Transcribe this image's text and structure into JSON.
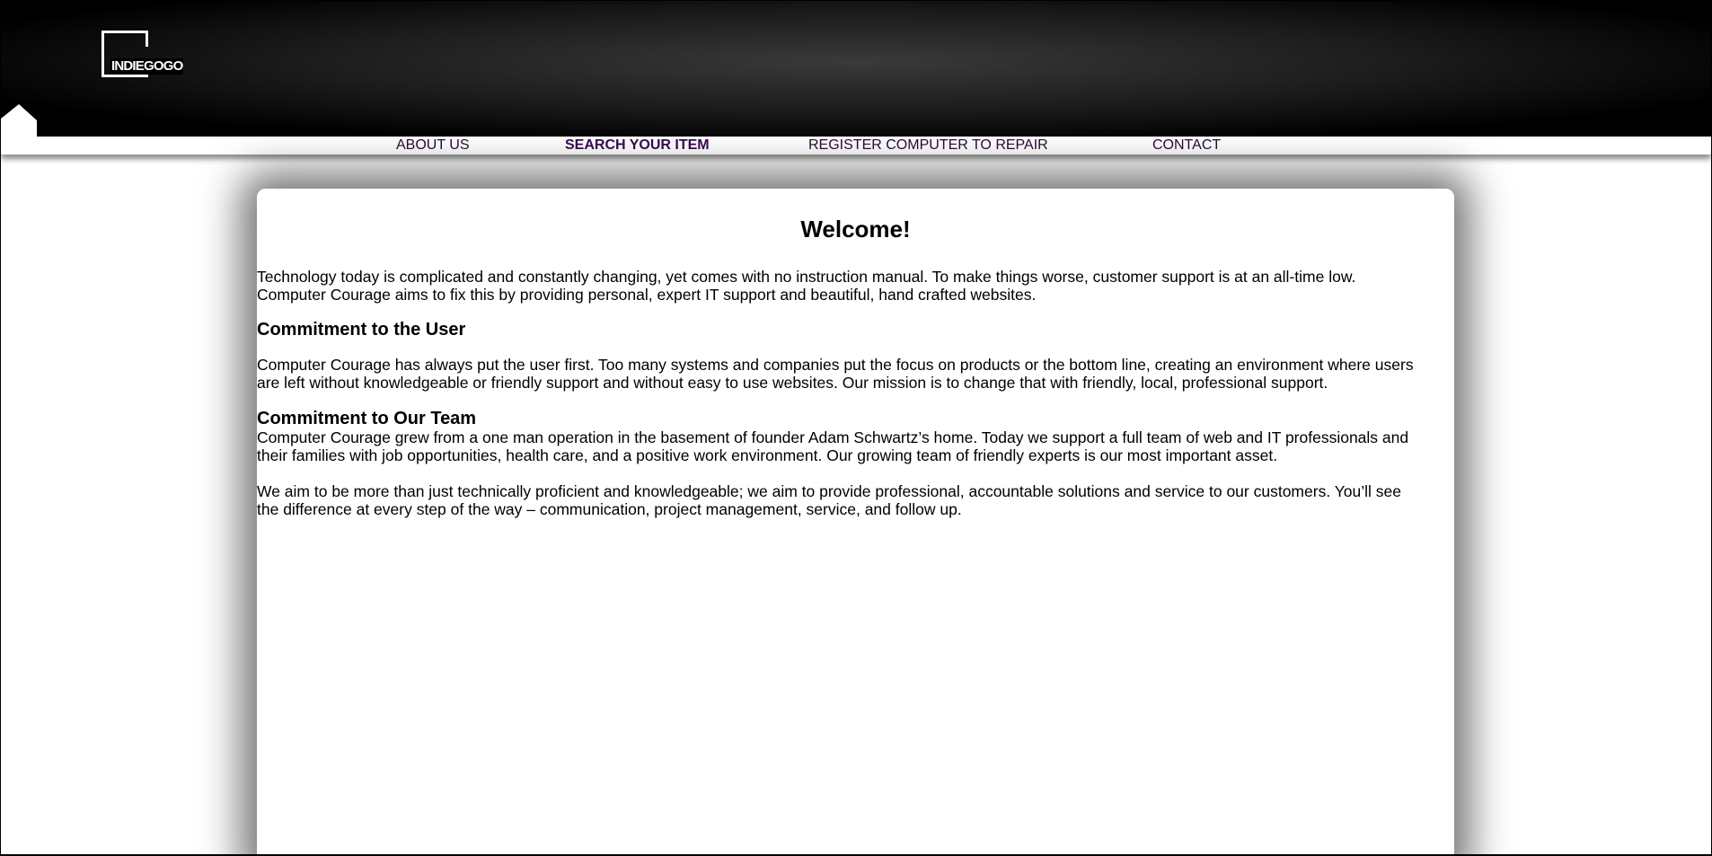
{
  "header": {
    "logo_text": "INDIEGOGO"
  },
  "nav": {
    "items": [
      {
        "label": "ABOUT US"
      },
      {
        "label": "SEARCH YOUR ITEM"
      },
      {
        "label": "REGISTER COMPUTER TO REPAIR"
      },
      {
        "label": "CONTACT"
      }
    ],
    "active": "SEARCH YOUR ITEM"
  },
  "main": {
    "title": "Welcome!",
    "intro_line1": "Technology today is complicated and constantly changing, yet comes with no instruction manual. To make things worse, customer support is at an all-time low.",
    "intro_line2": "Computer Courage aims to fix this by providing personal, expert IT support and beautiful, hand crafted websites.",
    "section1_heading": "Commitment to the User",
    "section1_line1": "Computer Courage has always put the user first. Too many systems and companies put the focus on products or the bottom line, creating an environment where users",
    "section1_line2": "are left without knowledgeable or friendly support and without easy to use websites. Our mission is to change that with friendly, local, professional support.",
    "section2_heading": "Commitment to Our Team",
    "section2_line1": "Computer Courage grew from a one man operation in the basement of founder Adam Schwartz’s home. Today we support a full team of web and IT professionals and",
    "section2_line2": "their families with job opportunities, health care, and a positive work environment. Our growing team of friendly experts is our most important asset.",
    "closing_line1": "We aim to be more than just technically proficient and knowledgeable; we aim to provide professional, accountable solutions and service to our customers. You’ll see",
    "closing_line2": "the difference at every step of the way – communication, project management, service, and follow up."
  },
  "icons": {
    "home": "home-icon",
    "logo": "indiegogo-logo"
  },
  "colors": {
    "header_bg": "#000000",
    "nav_text": "#2a0a3a",
    "page_bg": "#ffffff"
  }
}
